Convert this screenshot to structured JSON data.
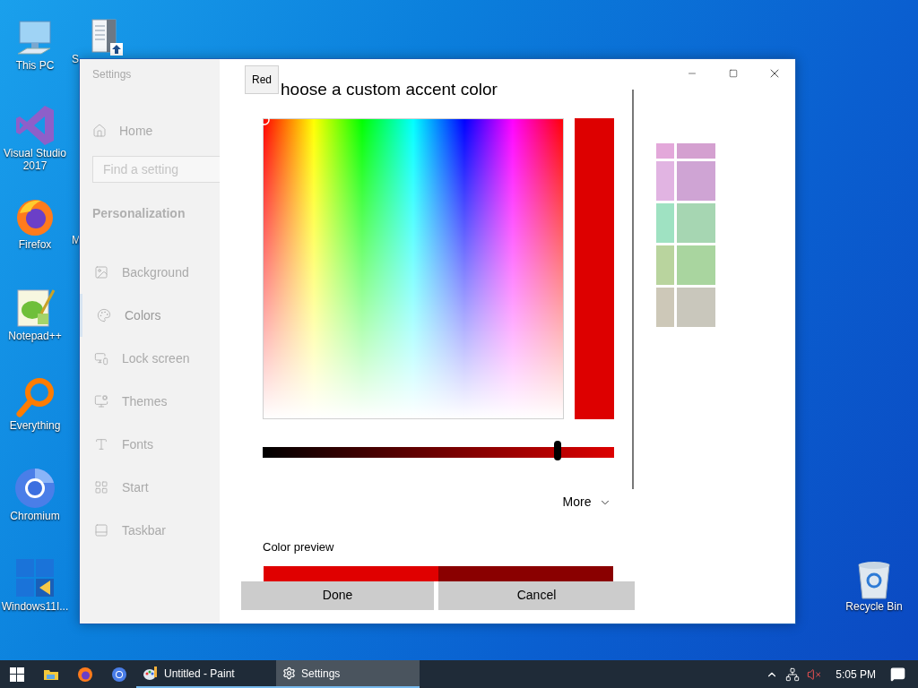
{
  "desktop_icons": [
    {
      "kind": "computer",
      "label": "This PC"
    },
    {
      "kind": "document",
      "label": "S"
    },
    {
      "kind": "visual-studio",
      "label": "Visual Studio 2017"
    },
    {
      "kind": "firefox",
      "label": "Firefox"
    },
    {
      "kind": "hidden",
      "label": "M"
    },
    {
      "kind": "notepad",
      "label": "Notepad++"
    },
    {
      "kind": "everything",
      "label": "Everything"
    },
    {
      "kind": "chromium",
      "label": "Chromium"
    },
    {
      "kind": "windows",
      "label": "Windows11I..."
    },
    {
      "kind": "recycle",
      "label": "Recycle Bin"
    }
  ],
  "window": {
    "title": "Settings",
    "sidebar": {
      "home": "Home",
      "search": {
        "placeholder": "Find a setting"
      },
      "section": "Personalization",
      "items": [
        {
          "label": "Background",
          "selected": false
        },
        {
          "label": "Colors",
          "selected": true
        },
        {
          "label": "Lock screen",
          "selected": false
        },
        {
          "label": "Themes",
          "selected": false
        },
        {
          "label": "Fonts",
          "selected": false
        },
        {
          "label": "Start",
          "selected": false
        },
        {
          "label": "Taskbar",
          "selected": false
        }
      ]
    },
    "accent_swatches": [
      {
        "color": "#e3a8da"
      },
      {
        "color": "#d4a0d0"
      },
      {
        "color": "#e1b4e2"
      },
      {
        "color": "#cfa4d4"
      },
      {
        "color": "#9fe2c2"
      },
      {
        "color": "#a6d6b2"
      },
      {
        "color": "#b9d49e"
      },
      {
        "color": "#a9d59f"
      },
      {
        "color": "#cdc8b8"
      },
      {
        "color": "#c9c7bc"
      }
    ],
    "dialog": {
      "tooltip": "Red",
      "title": "hoose a custom accent color",
      "selected_color": {
        "color": "#dd0000"
      },
      "brightness": {
        "level": 0.84
      },
      "more": "More",
      "preview_label": "Color preview",
      "preview": [
        {
          "color": "#e00000"
        },
        {
          "color": "#8a0000"
        }
      ],
      "buttons": [
        "Done",
        "Cancel"
      ]
    }
  },
  "taskbar": {
    "items": [
      {
        "kind": "start"
      },
      {
        "kind": "explorer"
      },
      {
        "kind": "firefox"
      },
      {
        "kind": "chromium"
      },
      {
        "kind": "paint",
        "label": "Untitled - Paint",
        "selected": false
      },
      {
        "kind": "settings",
        "label": "Settings",
        "selected": true
      }
    ],
    "clock": "5:05 PM"
  }
}
